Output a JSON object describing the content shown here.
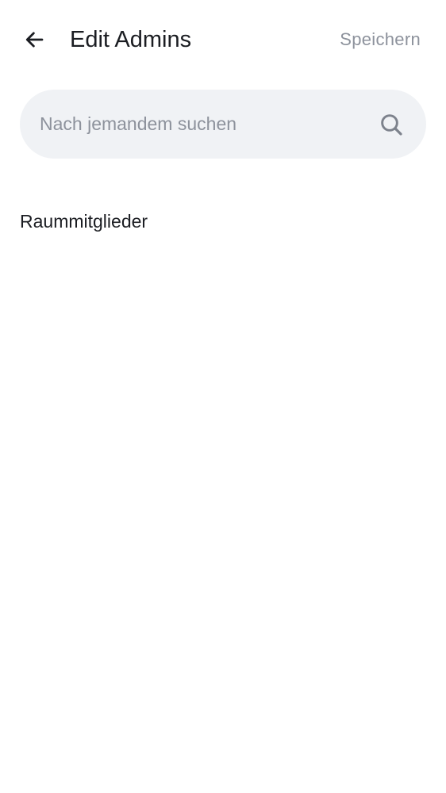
{
  "header": {
    "back_icon": "arrow-left-icon",
    "title": "Edit Admins",
    "save_label": "Speichern"
  },
  "search": {
    "placeholder": "Nach jemandem suchen",
    "value": "",
    "icon": "search-icon"
  },
  "members": {
    "section_title": "Raummitglieder",
    "items": []
  },
  "colors": {
    "text_primary": "#1b1d22",
    "text_muted": "#8d929c",
    "search_bg": "#f0f2f5",
    "background": "#ffffff"
  }
}
